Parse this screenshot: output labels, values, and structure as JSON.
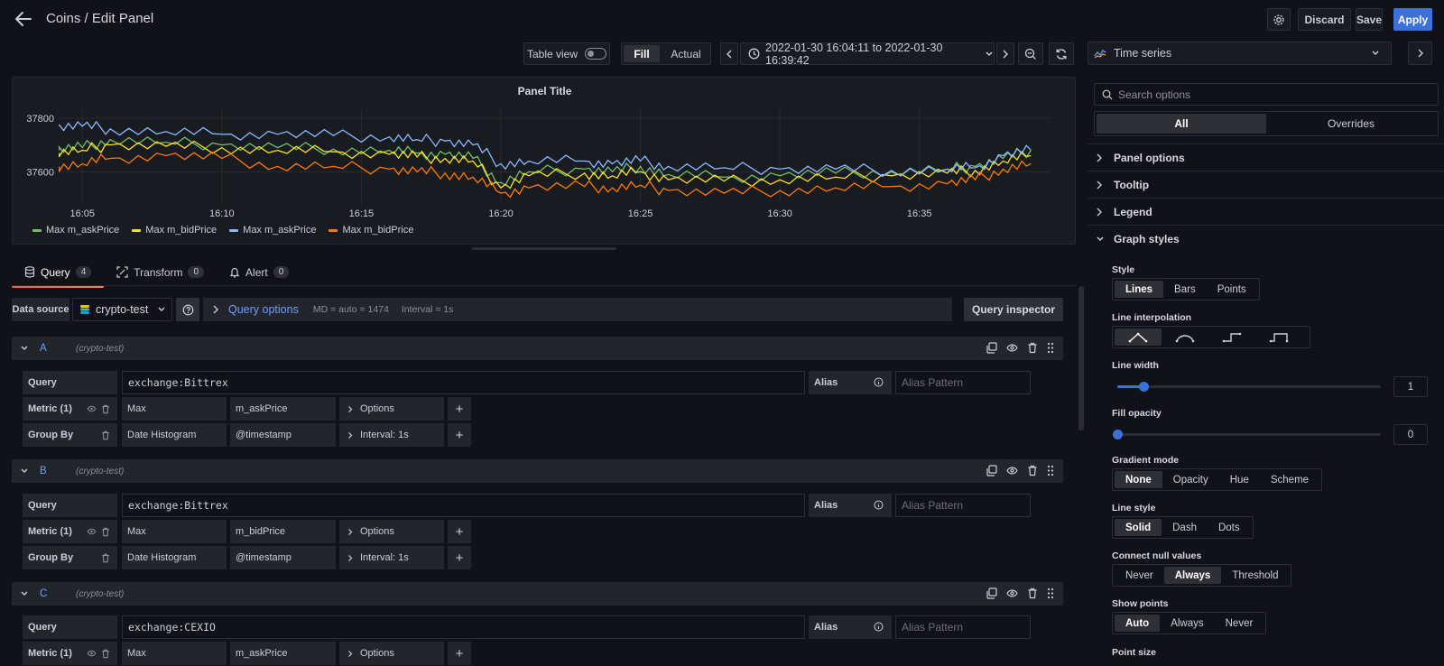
{
  "header": {
    "title": "Coins / Edit Panel",
    "discard_label": "Discard",
    "save_label": "Save",
    "apply_label": "Apply"
  },
  "toolbar": {
    "table_view_label": "Table view",
    "table_view_on": false,
    "fill_label": "Fill",
    "actual_label": "Actual",
    "time_range": "2022-01-30 16:04:11 to 2022-01-30 16:39:42"
  },
  "viz_picker": {
    "label": "Time series"
  },
  "panel": {
    "title": "Panel Title"
  },
  "chart_data": {
    "type": "line",
    "title": "Panel Title",
    "x_ticks": [
      "16:05",
      "16:10",
      "16:15",
      "16:20",
      "16:25",
      "16:30",
      "16:35"
    ],
    "y_ticks": [
      37600,
      37800
    ],
    "x_range": [
      "16:04:11",
      "16:39:42"
    ],
    "ylim": [
      37480,
      37830
    ],
    "grid": true,
    "legend_placement": "bottom-left",
    "x": [
      "16:04",
      "16:05",
      "16:06",
      "16:08",
      "16:10",
      "16:12",
      "16:14",
      "16:16",
      "16:17",
      "16:18",
      "16:19",
      "16:20",
      "16:21",
      "16:23",
      "16:24",
      "16:25",
      "16:26",
      "16:28",
      "16:30",
      "16:32",
      "16:34",
      "16:36",
      "16:37",
      "16:38",
      "16:39"
    ],
    "series": [
      {
        "name": "Max m_askPrice",
        "color": "#73bf69",
        "values": [
          37680,
          37690,
          37720,
          37710,
          37700,
          37690,
          37685,
          37680,
          37670,
          37665,
          37650,
          37560,
          37600,
          37610,
          37600,
          37620,
          37590,
          37580,
          37585,
          37595,
          37600,
          37610,
          37620,
          37650,
          37680
        ]
      },
      {
        "name": "Max m_bidPrice",
        "color": "#fade2a",
        "values": [
          37670,
          37680,
          37700,
          37695,
          37690,
          37680,
          37675,
          37665,
          37655,
          37650,
          37640,
          37540,
          37585,
          37595,
          37585,
          37600,
          37570,
          37565,
          37570,
          37580,
          37585,
          37595,
          37605,
          37640,
          37660
        ]
      },
      {
        "name": "Max m_askPrice",
        "color": "#8ab8ff",
        "values": [
          37770,
          37770,
          37760,
          37750,
          37740,
          37740,
          37735,
          37730,
          37720,
          37715,
          37700,
          37630,
          37640,
          37640,
          37630,
          37640,
          37620,
          37615,
          37610,
          37610,
          37605,
          37610,
          37615,
          37660,
          37680
        ]
      },
      {
        "name": "Max m_bidPrice",
        "color": "#ff780a",
        "values": [
          37620,
          37630,
          37650,
          37660,
          37650,
          37620,
          37620,
          37610,
          37600,
          37595,
          37580,
          37520,
          37540,
          37545,
          37540,
          37550,
          37530,
          37520,
          37530,
          37540,
          37545,
          37555,
          37570,
          37610,
          37630
        ]
      }
    ]
  },
  "tabs": [
    {
      "label": "Query",
      "count": "4"
    },
    {
      "label": "Transform",
      "count": "0"
    },
    {
      "label": "Alert",
      "count": "0"
    }
  ],
  "datasource": {
    "label": "Data source",
    "name": "crypto-test",
    "query_options_label": "Query options",
    "md_info": "MD = auto = 1474",
    "interval_info": "Interval = 1s",
    "inspector_label": "Query inspector"
  },
  "queries": [
    {
      "ref": "A",
      "datasource": "(crypto-test)",
      "query_label": "Query",
      "query": "exchange:Bittrex",
      "alias_label": "Alias",
      "alias_placeholder": "Alias Pattern",
      "metric_label": "Metric (1)",
      "metric_agg": "Max",
      "metric_field": "m_askPrice",
      "metric_options": "Options",
      "group_label": "Group By",
      "group_agg": "Date Histogram",
      "group_field": "@timestamp",
      "group_interval": "Interval: 1s"
    },
    {
      "ref": "B",
      "datasource": "(crypto-test)",
      "query_label": "Query",
      "query": "exchange:Bittrex",
      "alias_label": "Alias",
      "alias_placeholder": "Alias Pattern",
      "metric_label": "Metric (1)",
      "metric_agg": "Max",
      "metric_field": "m_bidPrice",
      "metric_options": "Options",
      "group_label": "Group By",
      "group_agg": "Date Histogram",
      "group_field": "@timestamp",
      "group_interval": "Interval: 1s"
    },
    {
      "ref": "C",
      "datasource": "(crypto-test)",
      "query_label": "Query",
      "query": "exchange:CEXIO",
      "alias_label": "Alias",
      "alias_placeholder": "Alias Pattern",
      "metric_label": "Metric (1)",
      "metric_agg": "Max",
      "metric_field": "m_askPrice",
      "metric_options": "Options"
    }
  ],
  "options_pane": {
    "search_placeholder": "Search options",
    "all_label": "All",
    "overrides_label": "Overrides",
    "sections": [
      "Panel options",
      "Tooltip",
      "Legend",
      "Graph styles"
    ],
    "style_label": "Style",
    "style_options": [
      "Lines",
      "Bars",
      "Points"
    ],
    "style_selected": "Lines",
    "line_interp_label": "Line interpolation",
    "line_width_label": "Line width",
    "line_width_value": "1",
    "line_width_fraction": 0.1,
    "fill_opacity_label": "Fill opacity",
    "fill_opacity_value": "0",
    "fill_opacity_fraction": 0,
    "gradient_label": "Gradient mode",
    "gradient_options": [
      "None",
      "Opacity",
      "Hue",
      "Scheme"
    ],
    "gradient_selected": "None",
    "line_style_label": "Line style",
    "line_style_options": [
      "Solid",
      "Dash",
      "Dots"
    ],
    "line_style_selected": "Solid",
    "connect_null_label": "Connect null values",
    "connect_null_options": [
      "Never",
      "Always",
      "Threshold"
    ],
    "connect_null_selected": "Always",
    "show_points_label": "Show points",
    "show_points_options": [
      "Auto",
      "Always",
      "Never"
    ],
    "show_points_selected": "Auto",
    "point_size_label": "Point size"
  }
}
